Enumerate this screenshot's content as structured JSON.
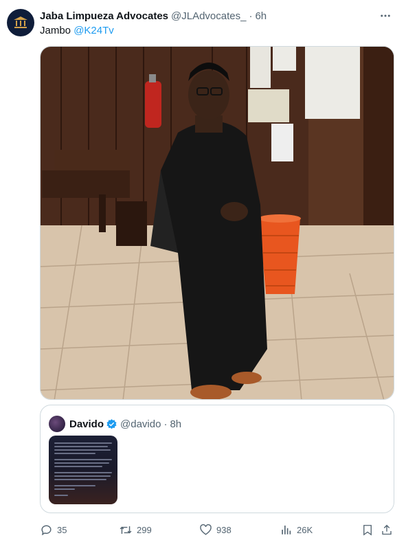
{
  "tweet": {
    "display_name": "Jaba Limpueza Advocates",
    "handle": "@JLAdvocates_",
    "separator": "·",
    "time": "6h",
    "text_prefix": "Jambo ",
    "mention": "@K24Tv"
  },
  "quote": {
    "display_name": "Davido",
    "handle": "@davido",
    "separator": "·",
    "time": "8h"
  },
  "actions": {
    "replies": "35",
    "retweets": "299",
    "likes": "938",
    "views": "26K"
  },
  "icons": [
    "more-icon",
    "reply-icon",
    "retweet-icon",
    "like-icon",
    "views-icon",
    "bookmark-icon",
    "share-icon",
    "verified-icon"
  ],
  "colors": {
    "accent": "#1d9bf0",
    "muted": "#536471",
    "border": "#cfd9de"
  }
}
